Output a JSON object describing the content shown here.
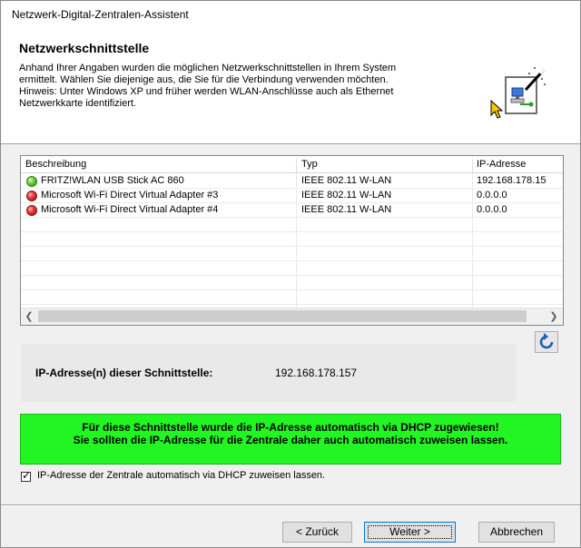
{
  "window": {
    "title": "Netzwerk-Digital-Zentralen-Assistent"
  },
  "header": {
    "title": "Netzwerkschnittstelle",
    "description": "Anhand Ihrer Angaben wurden die möglichen Netzwerkschnittstellen in Ihrem System\nermittelt. Wählen Sie diejenige aus, die Sie für die Verbindung verwenden möchten.\nHinweis: Unter Windows XP und früher werden WLAN-Anschlüsse auch als Ethernet\nNetzwerkkarte identifiziert.",
    "icon": "wizard-network-icon"
  },
  "table": {
    "columns": [
      "Beschreibung",
      "Typ",
      "IP-Adresse"
    ],
    "rows": [
      {
        "status": "green",
        "description": "FRITZ!WLAN USB Stick AC 860",
        "type": "IEEE 802.11 W-LAN",
        "ip": "192.168.178.15"
      },
      {
        "status": "red",
        "description": "Microsoft Wi-Fi Direct Virtual Adapter #3",
        "type": "IEEE 802.11 W-LAN",
        "ip": "0.0.0.0"
      },
      {
        "status": "red",
        "description": "Microsoft Wi-Fi Direct Virtual Adapter #4",
        "type": "IEEE 802.11 W-LAN",
        "ip": "0.0.0.0"
      }
    ]
  },
  "ip_info": {
    "label": "IP-Adresse(n) dieser Schnittstelle:",
    "value": "192.168.178.157"
  },
  "notice": {
    "line1": "Für diese Schnittstelle wurde die IP-Adresse automatisch via DHCP zugewiesen!",
    "line2": "Sie sollten die IP-Adresse für die Zentrale daher auch automatisch zuweisen lassen.",
    "color": "#22f522"
  },
  "dhcp_checkbox": {
    "label": "IP-Adresse der Zentrale automatisch via DHCP zuweisen lassen.",
    "checked": true
  },
  "buttons": {
    "back": "< Zurück",
    "next": "Weiter >",
    "cancel": "Abbrechen"
  }
}
